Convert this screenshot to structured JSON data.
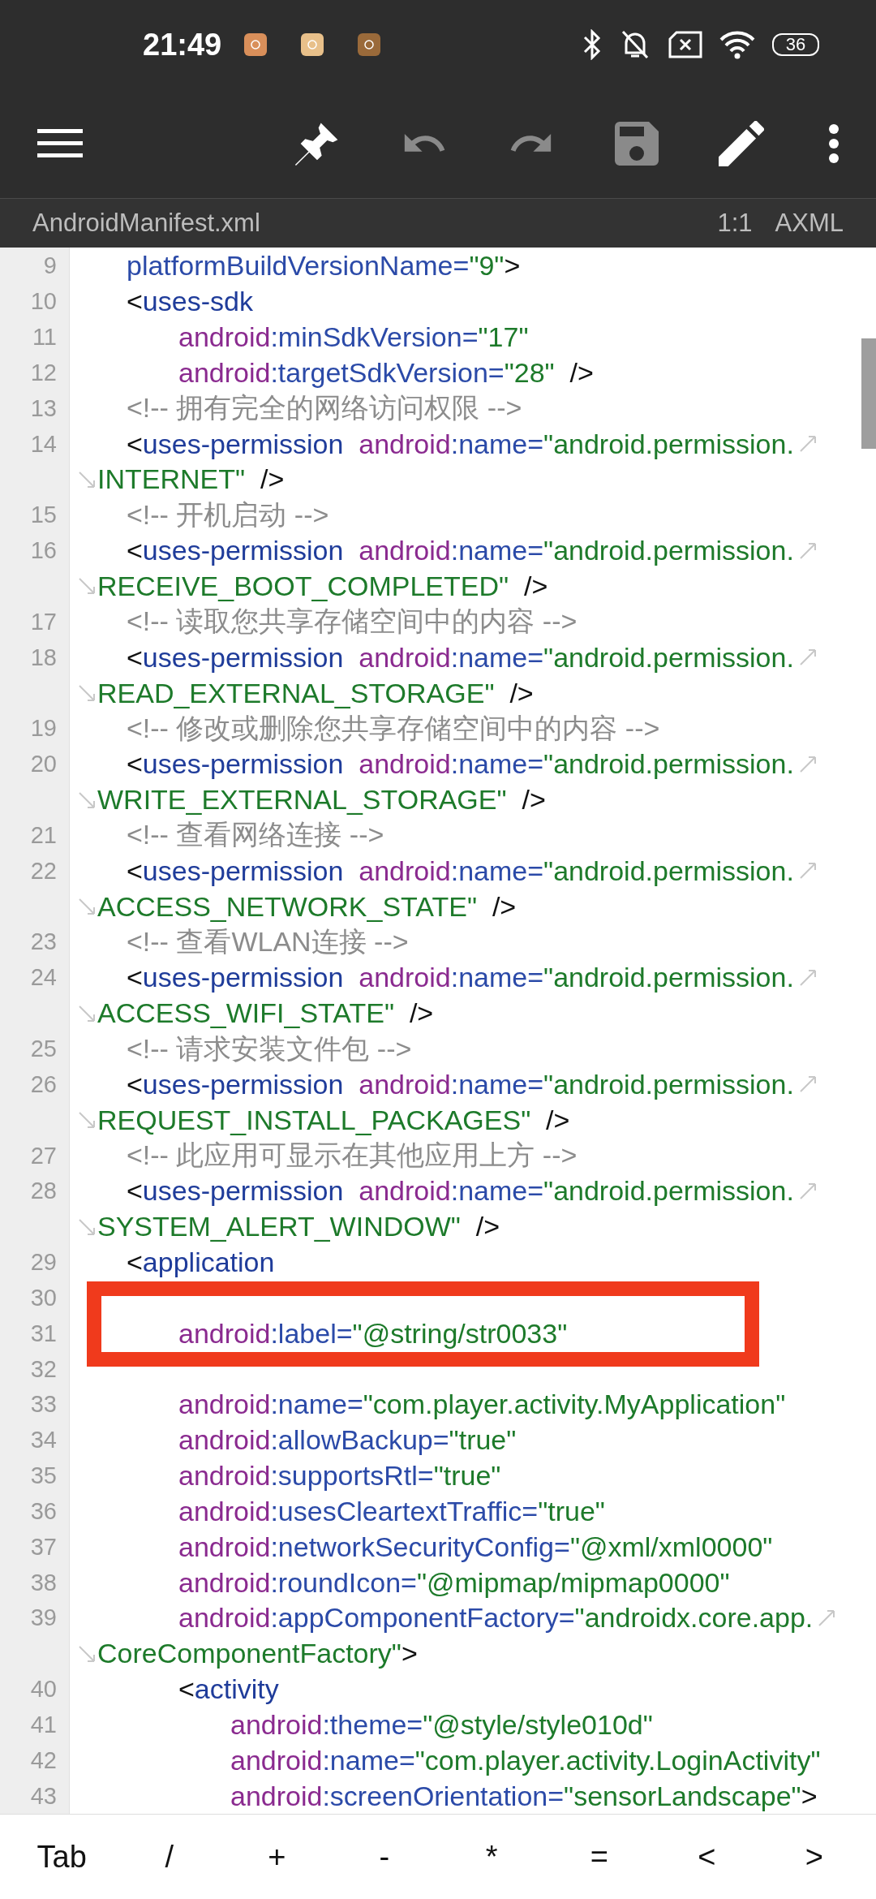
{
  "status_bar": {
    "time": "21:49",
    "battery": "36"
  },
  "toolbar": [
    {
      "kind": "menu",
      "disabled": false
    },
    {
      "kind": "pin",
      "disabled": false
    },
    {
      "kind": "undo",
      "disabled": true
    },
    {
      "kind": "redo",
      "disabled": true
    },
    {
      "kind": "save",
      "disabled": true
    },
    {
      "kind": "edit",
      "disabled": false
    },
    {
      "kind": "more",
      "disabled": false
    }
  ],
  "file_bar": {
    "file_name": "AndroidManifest.xml",
    "position": "1:1",
    "mode": "AXML"
  },
  "lines": [
    {
      "number": "9",
      "marked": false,
      "tokens": [
        {
          "kind": "attr",
          "text": "platformBuildVersionName="
        },
        {
          "kind": "value",
          "text": "\"9\""
        },
        {
          "kind": "punct",
          "text": ">"
        }
      ]
    },
    {
      "number": "10",
      "marked": false,
      "tokens": [
        {
          "kind": "punct",
          "text": "<"
        },
        {
          "kind": "tag",
          "text": "uses-sdk"
        }
      ],
      "children": [
        {
          "number": "11",
          "marked": false,
          "tokens": [
            {
              "kind": "ns",
              "text": "android"
            },
            {
              "kind": "attr",
              "text": ":minSdkVersion="
            },
            {
              "kind": "value",
              "text": "\"17\""
            }
          ]
        },
        {
          "number": "12",
          "marked": false,
          "tokens": [
            {
              "kind": "ns",
              "text": "android"
            },
            {
              "kind": "attr",
              "text": ":targetSdkVersion="
            },
            {
              "kind": "value",
              "text": "\"28\""
            },
            {
              "kind": "punct",
              "text": "  />"
            }
          ]
        }
      ]
    },
    {
      "number": "13",
      "marked": false,
      "tokens": [
        {
          "kind": "comment",
          "text": "<!-- 拥有完全的网络访问权限 -->"
        }
      ]
    },
    {
      "number": "14",
      "marked": false,
      "tokens": [
        {
          "kind": "punct",
          "text": "<"
        },
        {
          "kind": "tag",
          "text": "uses-permission  "
        },
        {
          "kind": "ns",
          "text": "android"
        },
        {
          "kind": "attr",
          "text": ":name="
        },
        {
          "kind": "value",
          "text": "\"android.permission."
        }
      ],
      "wrapped": [
        {
          "kind": "value",
          "text": "INTERNET\""
        },
        {
          "kind": "punct",
          "text": "  />"
        }
      ]
    },
    {
      "number": "15",
      "marked": false,
      "tokens": [
        {
          "kind": "comment",
          "text": "<!-- 开机启动 -->"
        }
      ]
    },
    {
      "number": "16",
      "marked": false,
      "tokens": [
        {
          "kind": "punct",
          "text": "<"
        },
        {
          "kind": "tag",
          "text": "uses-permission  "
        },
        {
          "kind": "ns",
          "text": "android"
        },
        {
          "kind": "attr",
          "text": ":name="
        },
        {
          "kind": "value",
          "text": "\"android.permission."
        }
      ],
      "wrapped": [
        {
          "kind": "value",
          "text": "RECEIVE_BOOT_COMPLETED\""
        },
        {
          "kind": "punct",
          "text": "  />"
        }
      ]
    },
    {
      "number": "17",
      "marked": false,
      "tokens": [
        {
          "kind": "comment",
          "text": "<!-- 读取您共享存储空间中的内容 -->"
        }
      ]
    },
    {
      "number": "18",
      "marked": false,
      "tokens": [
        {
          "kind": "punct",
          "text": "<"
        },
        {
          "kind": "tag",
          "text": "uses-permission  "
        },
        {
          "kind": "ns",
          "text": "android"
        },
        {
          "kind": "attr",
          "text": ":name="
        },
        {
          "kind": "value",
          "text": "\"android.permission."
        }
      ],
      "wrapped": [
        {
          "kind": "value",
          "text": "READ_EXTERNAL_STORAGE\""
        },
        {
          "kind": "punct",
          "text": "  />"
        }
      ]
    },
    {
      "number": "19",
      "marked": false,
      "tokens": [
        {
          "kind": "comment",
          "text": "<!-- 修改或删除您共享存储空间中的内容 -->"
        }
      ]
    },
    {
      "number": "20",
      "marked": false,
      "tokens": [
        {
          "kind": "punct",
          "text": "<"
        },
        {
          "kind": "tag",
          "text": "uses-permission  "
        },
        {
          "kind": "ns",
          "text": "android"
        },
        {
          "kind": "attr",
          "text": ":name="
        },
        {
          "kind": "value",
          "text": "\"android.permission."
        }
      ],
      "wrapped": [
        {
          "kind": "value",
          "text": "WRITE_EXTERNAL_STORAGE\""
        },
        {
          "kind": "punct",
          "text": "  />"
        }
      ]
    },
    {
      "number": "21",
      "marked": false,
      "tokens": [
        {
          "kind": "comment",
          "text": "<!-- 查看网络连接 -->"
        }
      ]
    },
    {
      "number": "22",
      "marked": false,
      "tokens": [
        {
          "kind": "punct",
          "text": "<"
        },
        {
          "kind": "tag",
          "text": "uses-permission  "
        },
        {
          "kind": "ns",
          "text": "android"
        },
        {
          "kind": "attr",
          "text": ":name="
        },
        {
          "kind": "value",
          "text": "\"android.permission."
        }
      ],
      "wrapped": [
        {
          "kind": "value",
          "text": "ACCESS_NETWORK_STATE\""
        },
        {
          "kind": "punct",
          "text": "  />"
        }
      ]
    },
    {
      "number": "23",
      "marked": false,
      "tokens": [
        {
          "kind": "comment",
          "text": "<!-- 查看WLAN连接 -->"
        }
      ]
    },
    {
      "number": "24",
      "marked": false,
      "tokens": [
        {
          "kind": "punct",
          "text": "<"
        },
        {
          "kind": "tag",
          "text": "uses-permission  "
        },
        {
          "kind": "ns",
          "text": "android"
        },
        {
          "kind": "attr",
          "text": ":name="
        },
        {
          "kind": "value",
          "text": "\"android.permission."
        }
      ],
      "wrapped": [
        {
          "kind": "value",
          "text": "ACCESS_WIFI_STATE\""
        },
        {
          "kind": "punct",
          "text": "  />"
        }
      ]
    },
    {
      "number": "25",
      "marked": false,
      "tokens": [
        {
          "kind": "comment",
          "text": "<!-- 请求安装文件包 -->"
        }
      ]
    },
    {
      "number": "26",
      "marked": false,
      "tokens": [
        {
          "kind": "punct",
          "text": "<"
        },
        {
          "kind": "tag",
          "text": "uses-permission  "
        },
        {
          "kind": "ns",
          "text": "android"
        },
        {
          "kind": "attr",
          "text": ":name="
        },
        {
          "kind": "value",
          "text": "\"android.permission."
        }
      ],
      "wrapped": [
        {
          "kind": "value",
          "text": "REQUEST_INSTALL_PACKAGES\""
        },
        {
          "kind": "punct",
          "text": "  />"
        }
      ]
    },
    {
      "number": "27",
      "marked": false,
      "tokens": [
        {
          "kind": "comment",
          "text": "<!-- 此应用可显示在其他应用上方 -->"
        }
      ]
    },
    {
      "number": "28",
      "marked": false,
      "tokens": [
        {
          "kind": "punct",
          "text": "<"
        },
        {
          "kind": "tag",
          "text": "uses-permission  "
        },
        {
          "kind": "ns",
          "text": "android"
        },
        {
          "kind": "attr",
          "text": ":name="
        },
        {
          "kind": "value",
          "text": "\"android.permission."
        }
      ],
      "wrapped": [
        {
          "kind": "value",
          "text": "SYSTEM_ALERT_WINDOW\""
        },
        {
          "kind": "punct",
          "text": "  />"
        }
      ]
    },
    {
      "number": "29",
      "marked": false,
      "tokens": [
        {
          "kind": "punct",
          "text": "<"
        },
        {
          "kind": "tag",
          "text": "application"
        }
      ],
      "children": [
        {
          "number": "30",
          "marked": false
        },
        {
          "number": "31",
          "marked": true,
          "tokens": [
            {
              "kind": "ns",
              "text": "android"
            },
            {
              "kind": "attr",
              "text": ":label="
            },
            {
              "kind": "value",
              "text": "\"@string/str0033\""
            }
          ]
        },
        {
          "number": "32",
          "marked": false
        },
        {
          "number": "33",
          "marked": false,
          "tokens": [
            {
              "kind": "ns",
              "text": "android"
            },
            {
              "kind": "attr",
              "text": ":name="
            },
            {
              "kind": "value",
              "text": "\"com.player.activity.MyApplication\""
            }
          ]
        },
        {
          "number": "34",
          "marked": false,
          "tokens": [
            {
              "kind": "ns",
              "text": "android"
            },
            {
              "kind": "attr",
              "text": ":allowBackup="
            },
            {
              "kind": "value",
              "text": "\"true\""
            }
          ]
        },
        {
          "number": "35",
          "marked": false,
          "tokens": [
            {
              "kind": "ns",
              "text": "android"
            },
            {
              "kind": "attr",
              "text": ":supportsRtl="
            },
            {
              "kind": "value",
              "text": "\"true\""
            }
          ]
        },
        {
          "number": "36",
          "marked": false,
          "tokens": [
            {
              "kind": "ns",
              "text": "android"
            },
            {
              "kind": "attr",
              "text": ":usesCleartextTraffic="
            },
            {
              "kind": "value",
              "text": "\"true\""
            }
          ]
        },
        {
          "number": "37",
          "marked": false,
          "tokens": [
            {
              "kind": "ns",
              "text": "android"
            },
            {
              "kind": "attr",
              "text": ":networkSecurityConfig="
            },
            {
              "kind": "value",
              "text": "\"@xml/xml0000\""
            }
          ]
        },
        {
          "number": "38",
          "marked": false,
          "tokens": [
            {
              "kind": "ns",
              "text": "android"
            },
            {
              "kind": "attr",
              "text": ":roundIcon="
            },
            {
              "kind": "value",
              "text": "\"@mipmap/mipmap0000\""
            }
          ]
        },
        {
          "number": "39",
          "marked": false,
          "tokens": [
            {
              "kind": "ns",
              "text": "android"
            },
            {
              "kind": "attr",
              "text": ":appComponentFactory="
            },
            {
              "kind": "value",
              "text": "\"androidx.core.app."
            }
          ],
          "wrapped": [
            {
              "kind": "value",
              "text": "CoreComponentFactory\""
            },
            {
              "kind": "punct",
              "text": ">"
            }
          ]
        },
        {
          "number": "40",
          "marked": false,
          "tokens": [
            {
              "kind": "punct",
              "text": "<"
            },
            {
              "kind": "tag",
              "text": "activity"
            }
          ],
          "children": [
            {
              "number": "41",
              "marked": false,
              "tokens": [
                {
                  "kind": "ns",
                  "text": "android"
                },
                {
                  "kind": "attr",
                  "text": ":theme="
                },
                {
                  "kind": "value",
                  "text": "\"@style/style010d\""
                }
              ]
            },
            {
              "number": "42",
              "marked": false,
              "tokens": [
                {
                  "kind": "ns",
                  "text": "android"
                },
                {
                  "kind": "attr",
                  "text": ":name="
                },
                {
                  "kind": "value",
                  "text": "\"com.player.activity.LoginActivity\""
                }
              ]
            },
            {
              "number": "43",
              "marked": false,
              "tokens": [
                {
                  "kind": "ns",
                  "text": "android"
                },
                {
                  "kind": "attr",
                  "text": ":screenOrientation="
                },
                {
                  "kind": "value",
                  "text": "\"sensorLandscape\""
                },
                {
                  "kind": "punct",
                  "text": ">"
                }
              ]
            }
          ]
        }
      ]
    }
  ],
  "keys": [
    "Tab",
    "/",
    "+",
    "-",
    "*",
    "=",
    "<",
    ">"
  ]
}
